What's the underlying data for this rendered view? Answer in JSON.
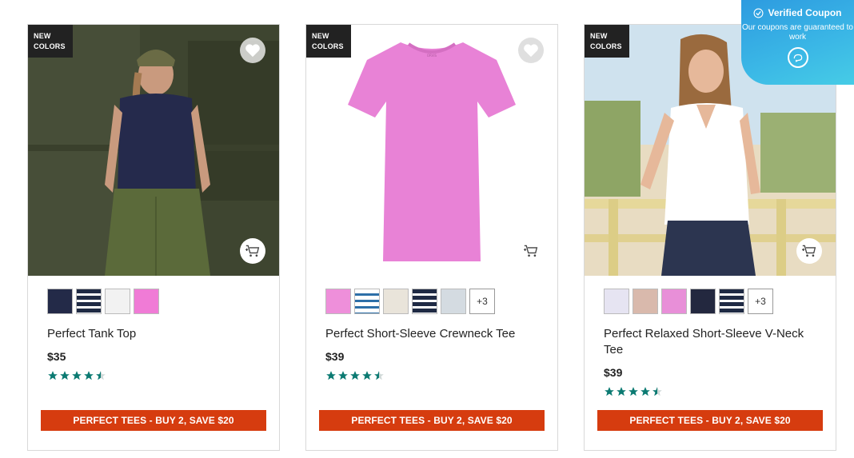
{
  "coupon": {
    "title": "Verified Coupon",
    "subtitle": "Our coupons are guaranteed to work"
  },
  "products": [
    {
      "badge_line1": "NEW",
      "badge_line2": "COLORS",
      "name": "Perfect Tank Top",
      "price": "$35",
      "rating": 4.5,
      "swatches": [
        "#232a48",
        "stripe",
        "#f2f2f2",
        "#f07bd6"
      ],
      "more": "",
      "promo": "PERFECT TEES - BUY 2, SAVE $20"
    },
    {
      "badge_line1": "NEW",
      "badge_line2": "COLORS",
      "name": "Perfect Short-Sleeve Crewneck Tee",
      "price": "$39",
      "rating": 4.5,
      "swatches": [
        "#ee8fda",
        "stripe-blue",
        "#e9e4da",
        "stripe",
        "#d4dbe1"
      ],
      "more": "+3",
      "promo": "PERFECT TEES - BUY 2, SAVE $20"
    },
    {
      "badge_line1": "NEW",
      "badge_line2": "COLORS",
      "name": "Perfect Relaxed Short-Sleeve V-Neck Tee",
      "price": "$39",
      "rating": 4.5,
      "swatches": [
        "#e6e4f2",
        "#d9b9ac",
        "#e88fd8",
        "#23283f",
        "stripe"
      ],
      "more": "+3",
      "promo": "PERFECT TEES - BUY 2, SAVE $20"
    }
  ],
  "colors": {
    "promo": "#d63c0f",
    "star": "#0b7a72",
    "coupon": "#3bb8e6"
  }
}
